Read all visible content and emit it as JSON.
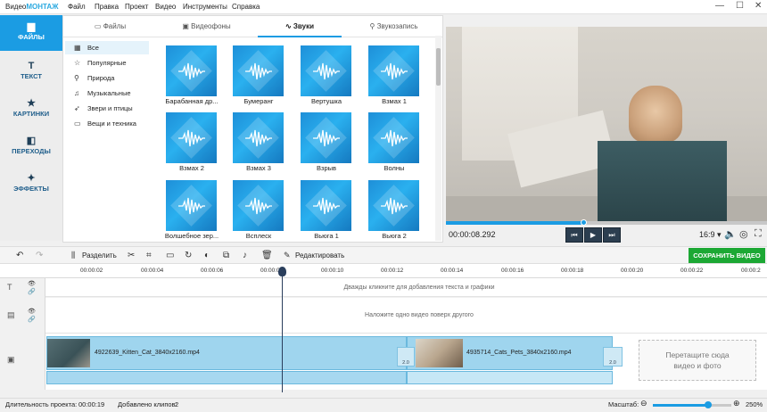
{
  "app": {
    "title_prefix": "Видео",
    "title_brand": "МОНТАЖ"
  },
  "menu": [
    "Файл",
    "Правка",
    "Проект",
    "Видео",
    "Инструменты",
    "Справка"
  ],
  "window_controls": {
    "minimize": "—",
    "maximize": "☐",
    "close": "✕"
  },
  "sidebar": {
    "items": [
      {
        "label": "ФАЙЛЫ",
        "icon": "folder-icon",
        "glyph": "▆",
        "active": true
      },
      {
        "label": "ТЕКСТ",
        "icon": "text-icon",
        "glyph": "T",
        "active": false
      },
      {
        "label": "КАРТИНКИ",
        "icon": "star-icon",
        "glyph": "★",
        "active": false
      },
      {
        "label": "ПЕРЕХОДЫ",
        "icon": "transitions-icon",
        "glyph": "◧",
        "active": false
      },
      {
        "label": "ЭФФЕКТЫ",
        "icon": "magic-wand-icon",
        "glyph": "✦",
        "active": false
      }
    ]
  },
  "library": {
    "tabs": [
      {
        "label": "Файлы",
        "icon": "files-icon",
        "glyph": "▭"
      },
      {
        "label": "Видеофоны",
        "icon": "video-bg-icon",
        "glyph": "▣"
      },
      {
        "label": "Звуки",
        "icon": "sound-wave-icon",
        "glyph": "∿",
        "active": true
      },
      {
        "label": "Звукозапись",
        "icon": "microphone-icon",
        "glyph": "⚲"
      }
    ],
    "categories": [
      {
        "label": "Все",
        "icon": "grid-icon",
        "glyph": "▦",
        "active": true
      },
      {
        "label": "Популярные",
        "icon": "star-outline-icon",
        "glyph": "☆"
      },
      {
        "label": "Природа",
        "icon": "pin-icon",
        "glyph": "⚲"
      },
      {
        "label": "Музыкальные",
        "icon": "music-note-icon",
        "glyph": "♫"
      },
      {
        "label": "Звери и птицы",
        "icon": "bird-icon",
        "glyph": "➶"
      },
      {
        "label": "Вещи и техника",
        "icon": "monitor-icon",
        "glyph": "▭"
      }
    ],
    "sounds": [
      "Барабанная др...",
      "Бумеранг",
      "Вертушка",
      "Взмах 1",
      "Взмах 2",
      "Взмах 3",
      "Взрыв",
      "Волны",
      "Волшебное зер...",
      "Всплеск",
      "Вьюга 1",
      "Вьюга 2"
    ]
  },
  "player": {
    "timecode": "00:00:08.292",
    "progress": 0.43,
    "aspect": "16:9",
    "aspect_caret": "▾",
    "buttons": {
      "prev": "⏮",
      "play": "▶",
      "next": "⏭"
    },
    "right_icons": {
      "volume": "🔈",
      "snapshot": "◎",
      "fullscreen": "⛶"
    }
  },
  "toolbar": {
    "undo": "↶",
    "redo": "↷",
    "split_label": "Разделить",
    "edit_label": "Редактировать",
    "save_label": "СОХРАНИТЬ ВИДЕО",
    "tools": [
      "✂",
      "⌗",
      "▭",
      "↻",
      "◐",
      "⧉",
      "♪",
      "🗑"
    ]
  },
  "ruler": [
    "00:00:02",
    "00:00:04",
    "00:00:06",
    "00:00:08",
    "00:00:10",
    "00:00:12",
    "00:00:14",
    "00:00:16",
    "00:00:18",
    "00:00:20",
    "00:00:22",
    "00:00:2"
  ],
  "timeline": {
    "text_hint": "Дважды кликните для добавления текста и графики",
    "overlay_hint": "Наложите одно видео поверх другого",
    "clips": [
      "4922639_Kitten_Cat_3840x2160.mp4",
      "4935714_Cats_Pets_3840x2160.mp4"
    ],
    "transition_badges": [
      "2.0",
      "2.0",
      "2.0"
    ],
    "dropzone": [
      "Перетащите сюда",
      "видео и фото"
    ],
    "track_icons": {
      "text": "T",
      "overlay": "▤",
      "video": "▣",
      "eye": "👁",
      "link": "🔗"
    }
  },
  "status": {
    "duration_label": "Длительность проекта:",
    "duration_value": "00:00:19",
    "clips_label": "Добавлено клипов:",
    "clips_value": "2",
    "scale_label": "Масштаб:",
    "zoom_out": "⊖",
    "zoom_in": "⊕",
    "zoom_value": "250%"
  },
  "colors": {
    "accent": "#1b9ce3",
    "save": "#1ca834",
    "clip": "#9fd5ee"
  }
}
